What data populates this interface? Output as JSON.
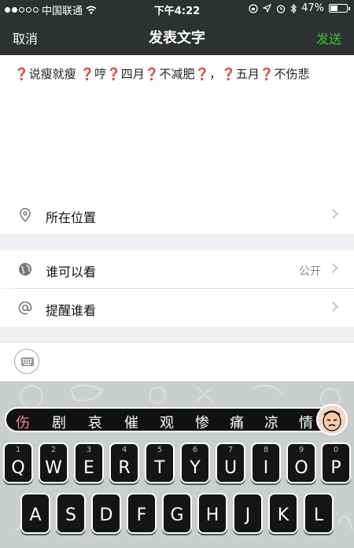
{
  "status_bar": {
    "carrier": "中国联通",
    "time": "下午4:22",
    "battery": "47%",
    "battery_level": 0.47
  },
  "nav": {
    "cancel_label": "取消",
    "title": "发表文字",
    "send_label": "发送"
  },
  "composer": {
    "text": "❓说瘦就瘦 ❓哼❓四月❓不减肥❓，❓五月❓不伤悲"
  },
  "location": {
    "label": "所在位置",
    "icon": "location-pin-icon"
  },
  "visibility": {
    "label": "谁可以看",
    "value": "公开",
    "icon": "globe-icon"
  },
  "mention": {
    "label": "提醒谁看",
    "icon": "at-icon"
  },
  "toolbar": {
    "keyboard_icon": "keyboard-icon"
  },
  "keyboard": {
    "candidates": [
      "伤",
      "剧",
      "哀",
      "催",
      "观",
      "惨",
      "痛",
      "凉",
      "情"
    ],
    "row1": [
      {
        "num": "1",
        "letter": "Q"
      },
      {
        "num": "2",
        "letter": "W"
      },
      {
        "num": "3",
        "letter": "E"
      },
      {
        "num": "4",
        "letter": "R"
      },
      {
        "num": "5",
        "letter": "T"
      },
      {
        "num": "6",
        "letter": "Y"
      },
      {
        "num": "7",
        "letter": "U"
      },
      {
        "num": "8",
        "letter": "I"
      },
      {
        "num": "9",
        "letter": "O"
      },
      {
        "num": "0",
        "letter": "P"
      }
    ],
    "row2": [
      "A",
      "S",
      "D",
      "F",
      "G",
      "H",
      "J",
      "K",
      "L"
    ]
  },
  "colors": {
    "header_bg": "#2e3132",
    "send_green": "#36c42b",
    "candidate_highlight": "#e98a8a"
  }
}
